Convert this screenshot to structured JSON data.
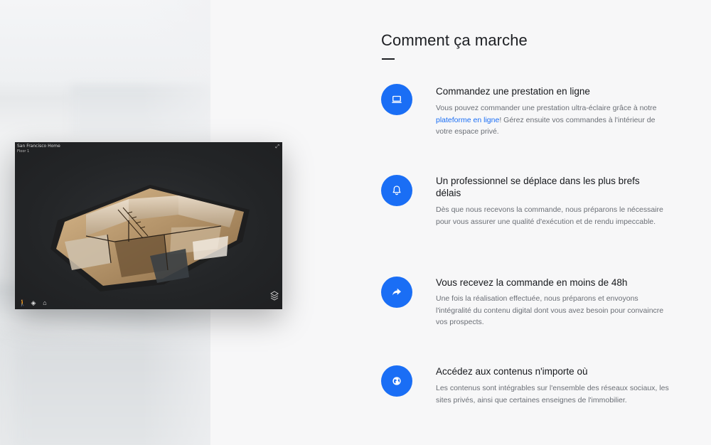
{
  "viewer": {
    "title": "San Francisco Home",
    "floor": "Floor 1"
  },
  "section": {
    "title": "Comment ça marche"
  },
  "colors": {
    "accent": "#1a6ef5",
    "title_text": "#16181c",
    "body_text": "#6b6f76"
  },
  "steps": [
    {
      "icon": "laptop-icon",
      "title": "Commandez une prestation en ligne",
      "desc_before": "Vous pouvez commander une prestation ultra-éclaire grâce à notre ",
      "desc_link": "plateforme en ligne",
      "desc_after": "! Gérez ensuite vos commandes à l'intérieur de votre espace privé."
    },
    {
      "icon": "bell-icon",
      "title": "Un professionnel se déplace dans les plus brefs délais",
      "desc": "Dès que nous recevons la commande, nous préparons le nécessaire pour vous assurer une qualité d'exécution et de rendu impeccable."
    },
    {
      "icon": "share-arrow-icon",
      "title": "Vous recevez la commande en moins de 48h",
      "desc": "Une fois la réalisation effectuée, nous préparons et envoyons l'intégralité du contenu digital dont vous avez besoin pour convaincre vos prospects."
    },
    {
      "icon": "globe-icon",
      "title": "Accédez aux contenus n'importe où",
      "desc": "Les contenus sont intégrables sur l'ensemble des réseaux sociaux, les sites privés, ainsi que certaines enseignes de l'immobilier."
    }
  ]
}
